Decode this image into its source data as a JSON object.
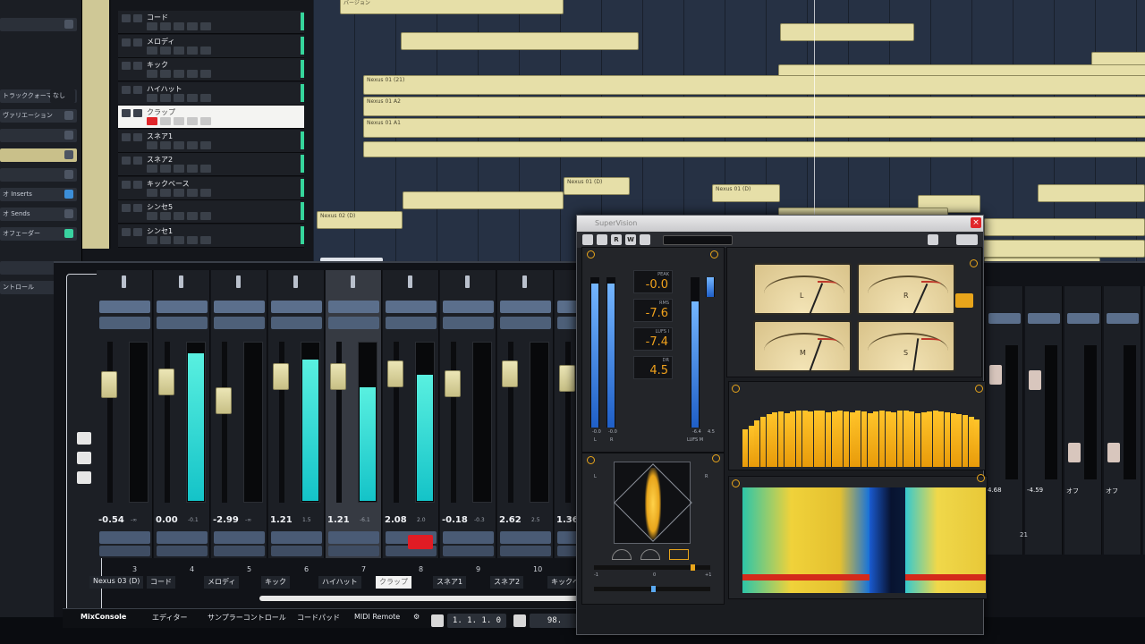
{
  "inspector": {
    "items": [
      "",
      "トラッククォーマー",
      "ヴァリエーション",
      "",
      "",
      "オ Inserts",
      "オ Sends",
      "オフェーダー",
      "",
      "ントロール"
    ],
    "side_value": "なし"
  },
  "tracks": [
    {
      "name": "コード"
    },
    {
      "name": "メロディ"
    },
    {
      "name": "キック"
    },
    {
      "name": "ハイハット"
    },
    {
      "name": "クラップ",
      "selected": true
    },
    {
      "name": "スネア1"
    },
    {
      "name": "スネア2"
    },
    {
      "name": "キックベース"
    },
    {
      "name": "シンセ5"
    },
    {
      "name": "シンセ1"
    }
  ],
  "arrange_parts": {
    "top_labels": [
      "バージョン"
    ],
    "nexus_labels": [
      "Nexus 01 (21)",
      "Nexus 01 A2",
      "Nexus 01 A1",
      "Nexus 01 (D)",
      "Nexus 01 (D)",
      "Nexus 02 (D)"
    ]
  },
  "mixer": {
    "channels": [
      {
        "num": "3",
        "name": "コード",
        "volume": "-0.54",
        "sub": "-∞",
        "fader": 0.78,
        "meter": 0.0
      },
      {
        "num": "4",
        "name": "メロディ",
        "volume": "0.00",
        "sub": "-0.1",
        "fader": 0.8,
        "meter": 0.94
      },
      {
        "num": "5",
        "name": "キック",
        "volume": "-2.99",
        "sub": "-∞",
        "fader": 0.66,
        "meter": 0.0
      },
      {
        "num": "6",
        "name": "ハイハット",
        "volume": "1.21",
        "sub": "1.5",
        "fader": 0.84,
        "meter": 0.9
      },
      {
        "num": "7",
        "name": "クラップ",
        "volume": "1.21",
        "sub": "-6.1",
        "fader": 0.84,
        "meter": 0.72,
        "selected": true
      },
      {
        "num": "8",
        "name": "スネア1",
        "volume": "2.08",
        "sub": "2.0",
        "fader": 0.86,
        "meter": 0.8,
        "rec": true
      },
      {
        "num": "9",
        "name": "スネア2",
        "volume": "-0.18",
        "sub": "-0.3",
        "fader": 0.79,
        "meter": 0.0
      },
      {
        "num": "10",
        "name": "キックベース",
        "volume": "2.62",
        "sub": "2.5",
        "fader": 0.86,
        "meter": 0.0
      },
      {
        "num": "",
        "name": "",
        "volume": "1.36",
        "sub": "",
        "fader": 0.83,
        "meter": 0.85
      }
    ],
    "first_label": "Nexus 03 (D)",
    "right_channels": [
      {
        "volume": "4.68",
        "fader": 0.84
      },
      {
        "volume": "-4.59",
        "fader": 0.8
      },
      {
        "volume": "オフ",
        "fader": 0.22
      },
      {
        "volume": "オフ",
        "fader": 0.22
      },
      {
        "volume": "オフ",
        "fader": 0.22
      }
    ],
    "right_num": "21"
  },
  "bottom_tabs": [
    "MixConsole",
    "エディター",
    "サンプラーコントロール",
    "コードパッド",
    "MIDI Remote"
  ],
  "transport": {
    "position": "1. 1. 1.  0",
    "tempo": "98."
  },
  "plugin": {
    "title": "SuperVision",
    "readouts": [
      {
        "label": "PEAK",
        "value": "-0.0"
      },
      {
        "label": "RMS",
        "value": "-7.6"
      },
      {
        "label": "LUFS I",
        "value": "-7.4"
      },
      {
        "label": "DR",
        "value": "4.5"
      }
    ],
    "meter_foot": [
      "-0.0",
      "-0.0",
      "-6.4",
      "4.5"
    ],
    "meter_foot_labels": [
      "L",
      "R",
      "LUFS M"
    ],
    "levels": {
      "left": 0.96,
      "right": 0.96,
      "lufs": 0.84,
      "dr": 0.14
    },
    "vu_meters": [
      "L",
      "R",
      "M",
      "S"
    ],
    "scope_labels": [
      "L",
      "R"
    ],
    "accent": "#e8a51b",
    "spectrum_bars": [
      0.58,
      0.64,
      0.72,
      0.78,
      0.82,
      0.85,
      0.86,
      0.84,
      0.86,
      0.88,
      0.87,
      0.86,
      0.88,
      0.87,
      0.85,
      0.86,
      0.88,
      0.86,
      0.85,
      0.87,
      0.86,
      0.84,
      0.86,
      0.88,
      0.86,
      0.85,
      0.87,
      0.88,
      0.86,
      0.84,
      0.85,
      0.86,
      0.88,
      0.86,
      0.85,
      0.84,
      0.82,
      0.8,
      0.78,
      0.74
    ],
    "pan_values": [
      "-1",
      "0",
      "+1"
    ]
  }
}
